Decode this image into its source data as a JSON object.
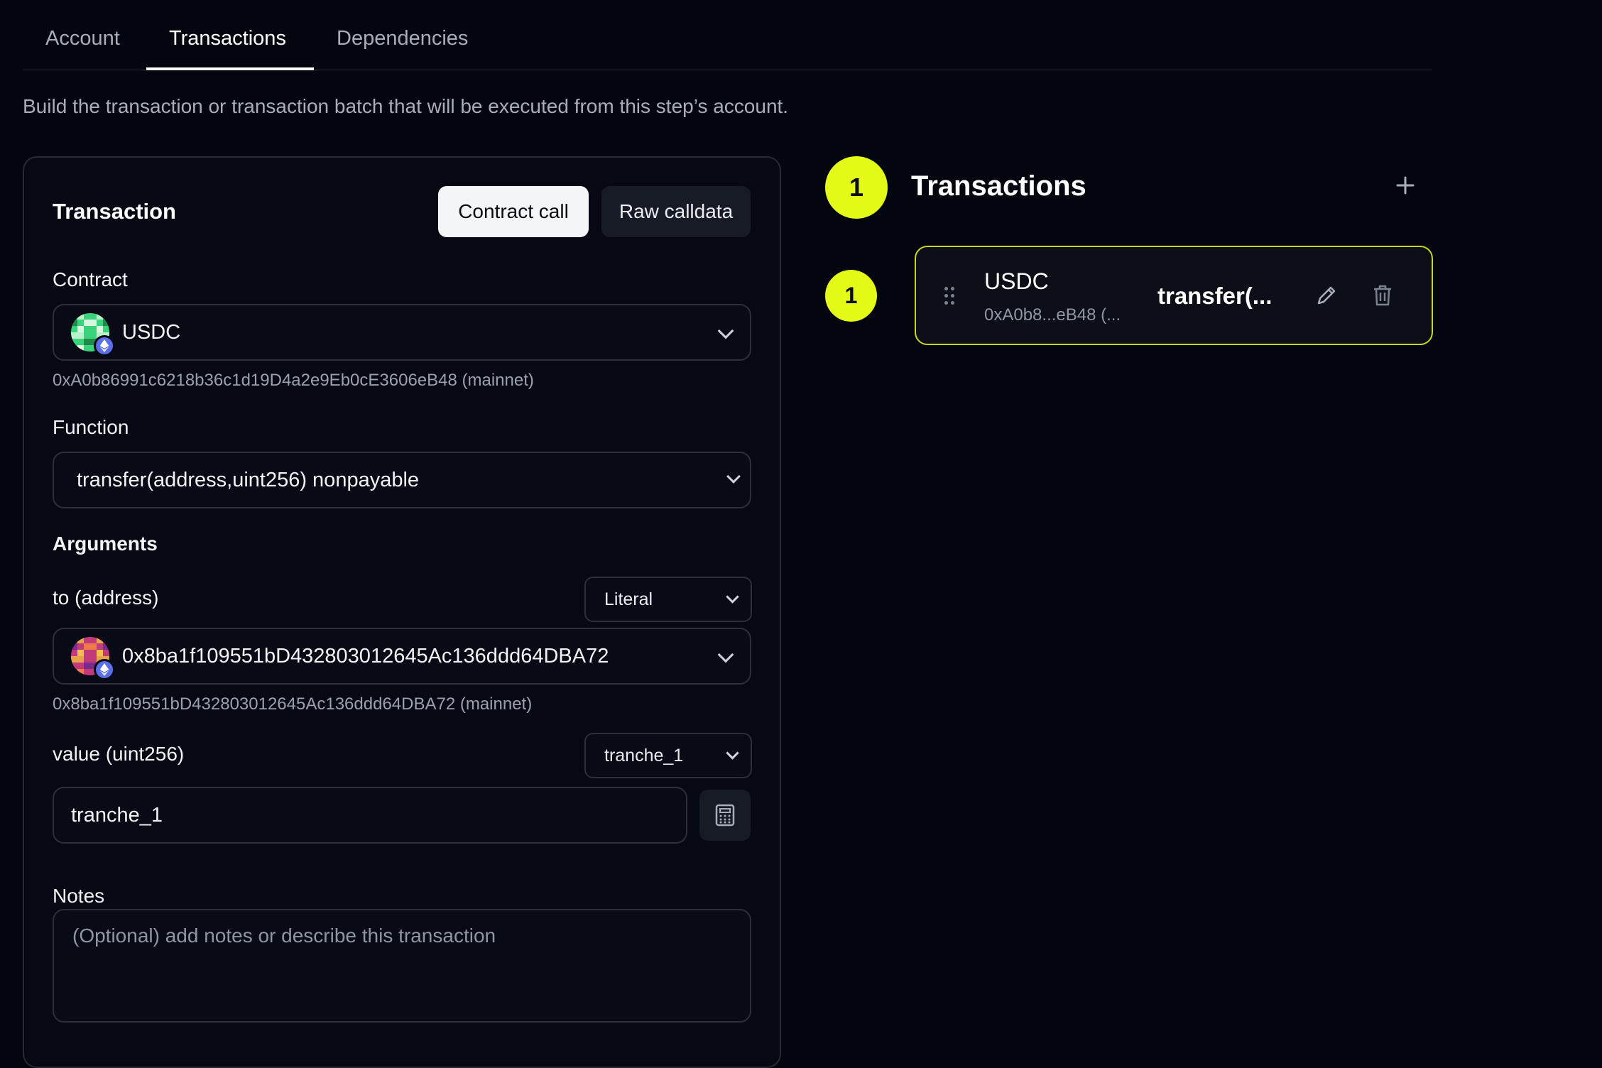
{
  "tabs": [
    {
      "label": "Account"
    },
    {
      "label": "Transactions"
    },
    {
      "label": "Dependencies"
    }
  ],
  "active_tab": "Transactions",
  "description": "Build the transaction or transaction batch that will be executed from this step’s account.",
  "transaction_panel": {
    "title": "Transaction",
    "mode_contract_call": "Contract call",
    "mode_raw_calldata": "Raw calldata",
    "contract": {
      "label": "Contract",
      "value": "USDC",
      "address_hint": "0xA0b86991c6218b36c1d19D4a2e9Eb0cE3606eB48 (mainnet)"
    },
    "function": {
      "label": "Function",
      "value": "transfer(address,uint256) nonpayable"
    },
    "arguments": {
      "label": "Arguments",
      "to": {
        "label": "to (address)",
        "mode": "Literal",
        "value": "0x8ba1f109551bD432803012645Ac136ddd64DBA72",
        "address_hint": "0x8ba1f109551bD432803012645Ac136ddd64DBA72 (mainnet)"
      },
      "value": {
        "label": "value (uint256)",
        "mode": "tranche_1",
        "value": "tranche_1"
      }
    },
    "notes": {
      "label": "Notes",
      "placeholder": "(Optional) add notes or describe this transaction"
    }
  },
  "transactions_list": {
    "count_badge": "1",
    "title": "Transactions",
    "items": [
      {
        "index": "1",
        "contract": "USDC",
        "address_short": "0xA0b8...eB48 (...",
        "function_short": "transfer(..."
      }
    ]
  },
  "colors": {
    "accent": "#e3fb16",
    "background": "#04060f",
    "card_border": "#c9d61e"
  }
}
